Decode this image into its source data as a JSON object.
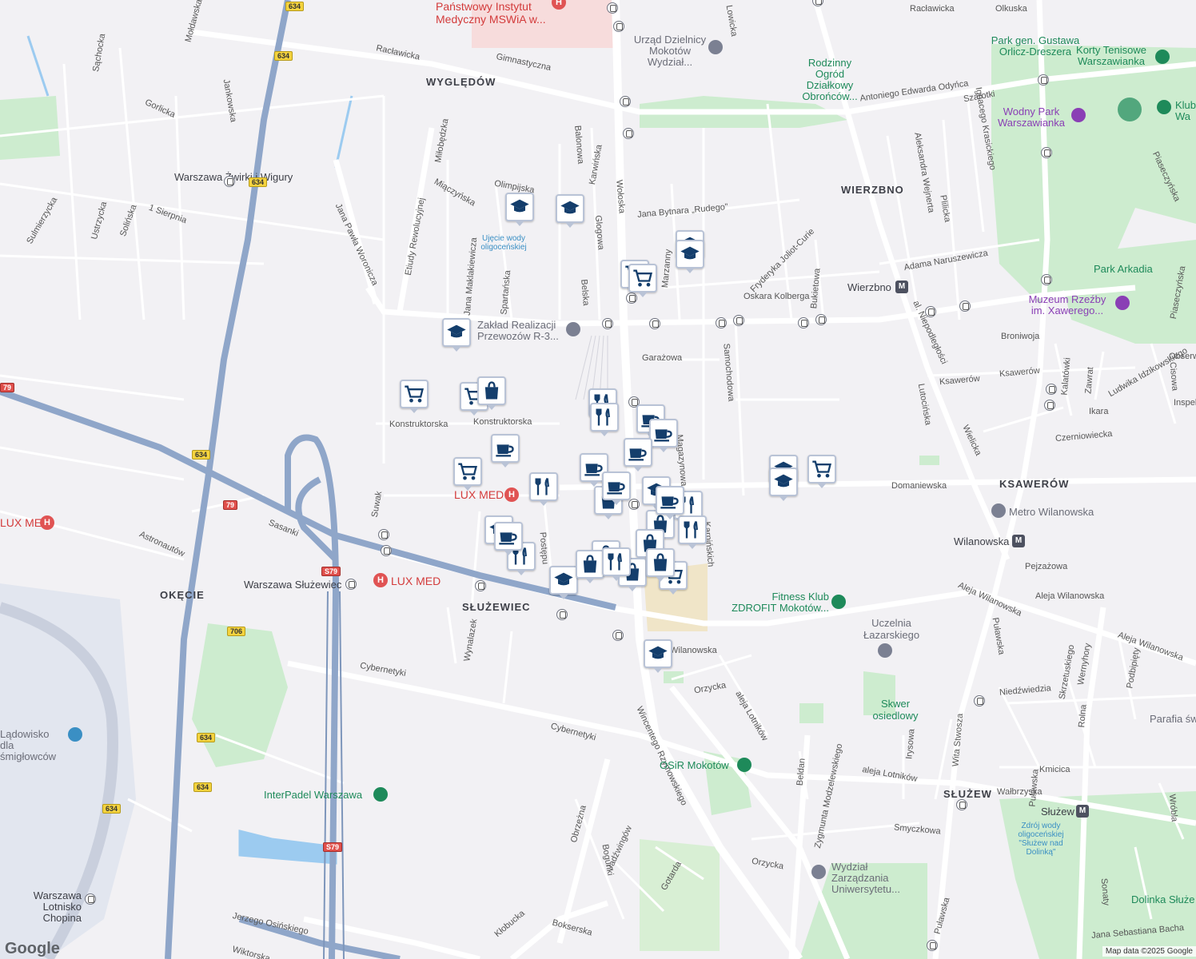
{
  "map": {
    "attribution": "Map data ©2025 Google",
    "logo": "Google",
    "colors": {
      "background": "#f2f1f4",
      "road": "#ffffff",
      "highway": "#8fa6c9",
      "park": "#cdeccf",
      "water": "#9ccbf0",
      "pin_border": "#b9c3d6",
      "pin_icon": "#143e6c"
    },
    "districts": [
      "WYGLĘDÓW",
      "WIERZBNO",
      "KSAWERÓW",
      "OKĘCIE",
      "SŁUŻEWIEC",
      "SŁUŻEW"
    ],
    "roads": [
      "Racławicka",
      "Gimnastyczna",
      "Gorlicka",
      "Jankowska",
      "Sąchocka",
      "Mołdawska",
      "Sulmierzycka",
      "Ustrzycka",
      "Solińska",
      "1 Sierpnia",
      "Jana Pawła Woronicza",
      "Etiudy Rewolucyjnej",
      "Miłobędzka",
      "Miączyńska",
      "Olimpijska",
      "Balonowa",
      "Karwińska",
      "Glogowa",
      "Wołoska",
      "Jana Bytnara „Rudego”",
      "Marzanny",
      "Belska",
      "Spartańska",
      "Jana Maklakiewicza",
      "Oskara Kolberga",
      "Garażowa",
      "Samochodowa",
      "Bukietowa",
      "Fryderyka Joliot-Curie",
      "Konstruktorska",
      "Magazynowa",
      "Domaniewska",
      "Postępu",
      "Suwak",
      "Sasanki",
      "Astronautów",
      "Wynalazek",
      "Cybernetyki",
      "Wincentego Rzymowskiego",
      "Obrzeżna",
      "Bokserska",
      "Kłobucka",
      "Jerzego Osińskiego",
      "Bogunki",
      "Jadźwingów",
      "Gotarda",
      "Orzycka",
      "aleja Lotników",
      "Zygmunta Modzelewskiego",
      "Beldan",
      "Irysowa",
      "Wita Stwosza",
      "Puławska",
      "Wałbrzyska",
      "Smyczkowa",
      "Kmicica",
      "Niedźwiedzia",
      "Rolna",
      "Aleja Wilanowska",
      "Wilanowska",
      "Pejzażowa",
      "Ksawerów",
      "Ikara",
      "Czerniowiecka",
      "Lutocińska",
      "Wielicka",
      "al. Niepodległości",
      "Broniwoja",
      "Kalatówki",
      "Zawrat",
      "Cisowa",
      "Inspektowa",
      "Obserwatorów",
      "Ludwika Idzikowskiego",
      "Piaseczyńska",
      "Adama Naruszewicza",
      "Aleksandra Wejnerta",
      "Plilicka",
      "Ignacego Krasickiego",
      "Antoniego Edwarda Odyńca",
      "Szarotki",
      "Olkuska",
      "Lowicka",
      "Skrzetuskiego",
      "Wernyhory",
      "Podbipięty",
      "Sonaty",
      "Wróbla",
      "Jana Sebastiana Bacha",
      "Wiktorska",
      "Karpińskich"
    ],
    "places": [
      "Warszawa Żwirki i Wigury",
      "Warszawa Służewiec",
      "Warszawa Lotnisko Chopina",
      "Wierzbno",
      "Wilanowska",
      "Służew",
      "Ujęcie wody oligoceńskiej",
      "Zdrój wody oligoceńskiej \"Służew nad Dolinką\"",
      "Skwer osiedlowy",
      "Uczelnia Łazarskiego",
      "Metro Wilanowska",
      "Park Arkadia",
      "Dolinka Służe",
      "Parafia św"
    ],
    "pois": [
      {
        "name": "Państwowy Instytut Medyczny MSWiA w...",
        "kind": "hospital"
      },
      {
        "name": "Urząd Dzielnicy Mokotów Wydział...",
        "kind": "government"
      },
      {
        "name": "Rodzinny Ogród Działkowy Obrońców...",
        "kind": "park"
      },
      {
        "name": "Park gen. Gustawa Orlicz-Dreszera",
        "kind": "park"
      },
      {
        "name": "Korty Tenisowe Warszawianka",
        "kind": "sport"
      },
      {
        "name": "Wodny Park Warszawianka",
        "kind": "attraction"
      },
      {
        "name": "Klub Wa",
        "kind": "sport"
      },
      {
        "name": "Muzeum Rzeźby im. Xawerego...",
        "kind": "museum"
      },
      {
        "name": "Zakład Realizacji Przewozów R-3...",
        "kind": "government"
      },
      {
        "name": "LUX MED",
        "kind": "hospital"
      },
      {
        "name": "LUX MED",
        "kind": "hospital"
      },
      {
        "name": "LUX MED",
        "kind": "hospital"
      },
      {
        "name": "Fitness Klub ZDROFIT Mokotów...",
        "kind": "sport"
      },
      {
        "name": "OSiR Mokotów",
        "kind": "sport"
      },
      {
        "name": "InterPadel Warszawa",
        "kind": "sport"
      },
      {
        "name": "Wydział Zarządzania Uniwersytetu...",
        "kind": "university"
      },
      {
        "name": "Lądowisko dla śmigłowców",
        "kind": "airport"
      }
    ],
    "route_shields": [
      "634",
      "634",
      "634",
      "634",
      "634",
      "634",
      "634",
      "79",
      "79",
      "S79",
      "S79",
      "706"
    ],
    "metro_labels": [
      "M",
      "M",
      "M"
    ]
  }
}
